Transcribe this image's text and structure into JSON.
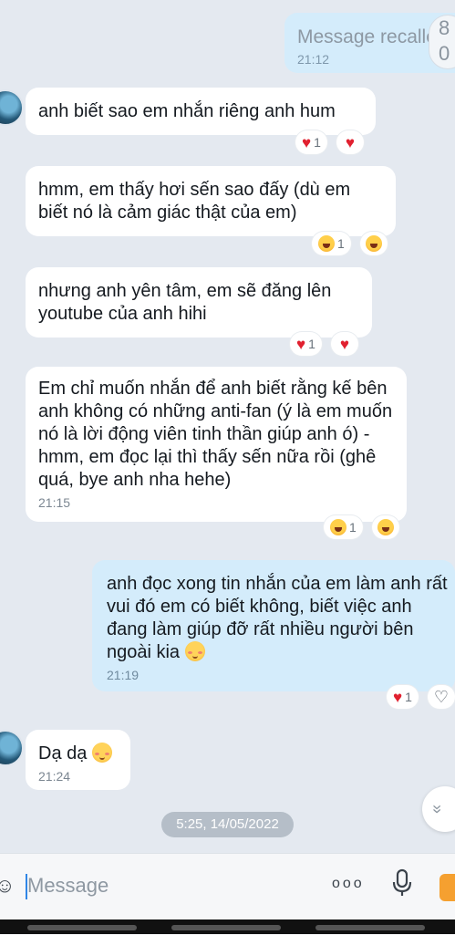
{
  "messages": [
    {
      "text": "Message recalled",
      "time": "21:12"
    },
    {
      "text": "anh biết sao em nhắn riêng anh hum",
      "reaction_count": "1"
    },
    {
      "text": "hmm, em thấy hơi sến sao đấy (dù em biết nó là cảm giác thật của em)",
      "reaction_count": "1"
    },
    {
      "text": "nhưng anh yên tâm, em sẽ đăng lên youtube của anh hihi",
      "reaction_count": "1"
    },
    {
      "text": "Em chỉ muốn nhắn để anh biết rằng kế bên anh không có những anti-fan (ý là em muốn nó là lời động viên tinh thần giúp anh ó) - hmm, em đọc lại thì thấy sến nữa rồi (ghê quá, bye anh nha hehe)",
      "time": "21:15",
      "reaction_count": "1"
    },
    {
      "text": "anh đọc xong tin nhắn của em làm anh rất vui đó em có biết không, biết việc anh đang làm giúp đỡ rất nhiều người bên ngoài kia",
      "time": "21:19",
      "reaction_count": "1"
    },
    {
      "text": "Dạ dạ",
      "time": "21:24"
    }
  ],
  "date_separator": "5:25, 14/05/2022",
  "composer": {
    "placeholder": "Message"
  },
  "icons": {
    "heart": "♥",
    "heart_outline": "♡",
    "scroll_down": "»",
    "mic": "🎙",
    "more": "ooo"
  },
  "colors": {
    "incoming_bubble": "#ffffff",
    "outgoing_bubble": "#d4ecfb",
    "heart": "#e1202f"
  }
}
